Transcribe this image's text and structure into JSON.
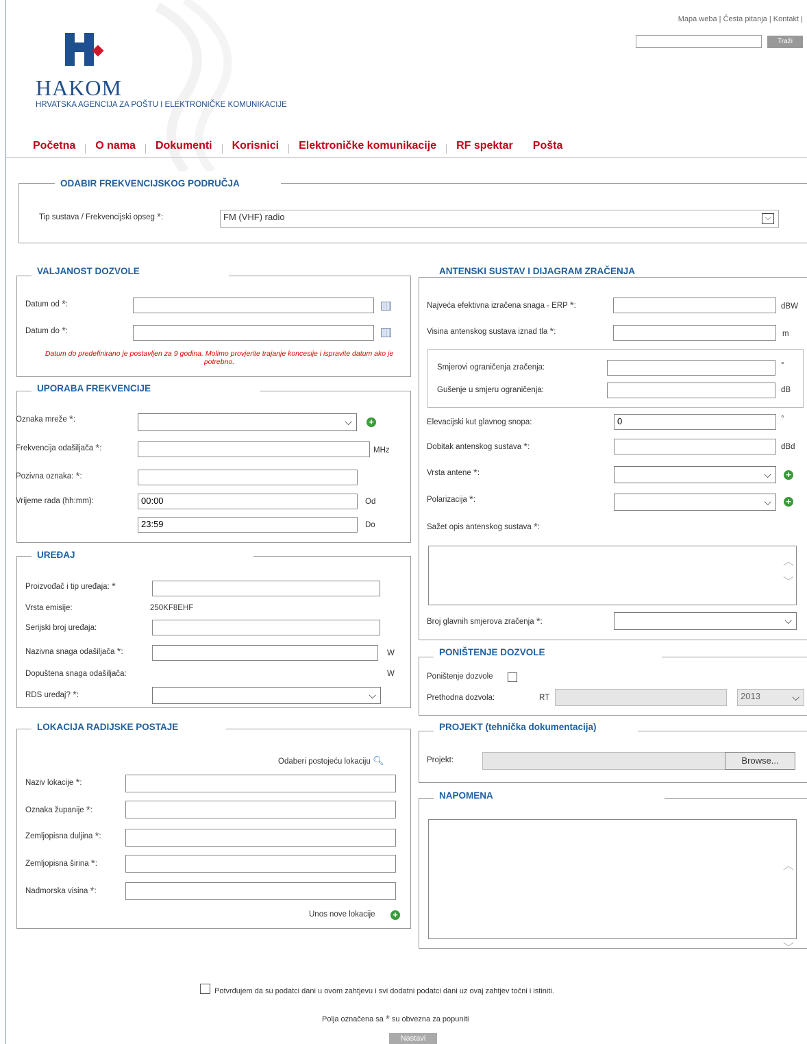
{
  "header": {
    "links": [
      "Mapa weba",
      "Česta pitanja",
      "Kontakt"
    ],
    "search_button": "Traži",
    "brand": "HAKOM",
    "subtitle": "HRVATSKA AGENCIJA ZA POŠTU I ELEKTRONIČKE KOMUNIKACIJE"
  },
  "nav": [
    "Početna",
    "O nama",
    "Dokumenti",
    "Korisnici",
    "Elektroničke komunikacije",
    "RF spektar",
    "Pošta"
  ],
  "freq": {
    "legend": "ODABIR FREKVENCIJSKOG PODRUČJA",
    "label": "Tip sustava / Frekvencijski opseg",
    "value": "FM (VHF) radio"
  },
  "validity": {
    "legend": "VALJANOST DOZVOLE",
    "date_from": "Datum od",
    "date_to": "Datum do",
    "note": "Datum do predefinirano je postavljen za 9 godina. Molimo provjerite trajanje koncesije i ispravite datum ako je potrebno."
  },
  "usage": {
    "legend": "UPORABA FREKVENCIJE",
    "network": "Oznaka mreže",
    "freq": "Frekvencija odašiljača",
    "freq_unit": "MHz",
    "callsign": "Pozivna oznaka:",
    "time": "Vrijeme rada (hh:mm):",
    "time_from": "00:00",
    "time_to": "23:59",
    "from_lbl": "Od",
    "to_lbl": "Do"
  },
  "device": {
    "legend": "UREĐAJ",
    "maker": "Proizvođač i tip uređaja:",
    "emission_lbl": "Vrsta emisije:",
    "emission_val": "250KF8EHF",
    "serial": "Serijski broj uređaja:",
    "power": "Nazivna snaga odašiljača",
    "power_unit": "W",
    "allowed": "Dopuštena snaga odašiljača:",
    "allowed_unit": "W",
    "rds": "RDS uređaj?"
  },
  "location": {
    "legend": "LOKACIJA RADIJSKE POSTAJE",
    "choose": "Odaberi postojeću lokaciju",
    "name": "Naziv lokacije",
    "county": "Oznaka županije",
    "lon": "Zemljopisna duljina",
    "lat": "Zemljopisna širina",
    "alt": "Nadmorska visina",
    "new_loc": "Unos nove lokacije"
  },
  "antenna": {
    "legend": "ANTENSKI SUSTAV I DIJAGRAM ZRAČENJA",
    "erp": "Najveća efektivna izračena snaga - ERP",
    "erp_unit": "dBW",
    "height": "Visina antenskog sustava iznad tla",
    "height_unit": "m",
    "dirs": "Smjerovi ograničenja zračenja:",
    "dirs_unit": "°",
    "att": "Gušenje u smjeru ograničenja:",
    "att_unit": "dB",
    "elev": "Elevacijski kut glavnog snopa:",
    "elev_val": "0",
    "elev_unit": "°",
    "gain": "Dobitak antenskog sustava",
    "gain_unit": "dBd",
    "type": "Vrsta antene",
    "pol": "Polarizacija",
    "desc": "Sažet opis antenskog sustava",
    "dircount": "Broj glavnih smjerova zračenja"
  },
  "cancel": {
    "legend": "PONIŠTENJE DOZVOLE",
    "cancel_lbl": "Poništenje dozvole",
    "prev": "Prethodna dozvola:",
    "rt": "RT",
    "year": "2013"
  },
  "project": {
    "legend": "PROJEKT (tehnička dokumentacija)",
    "label": "Projekt:",
    "browse": "Browse..."
  },
  "note": {
    "legend": "NAPOMENA"
  },
  "footer": {
    "confirm": "Potvrđujem da su podatci dani u ovom zahtjevu i svi dodatni podatci dani uz ovaj zahtjev točni i istiniti.",
    "req_pre": "Polja označena sa",
    "req_post": "su obvezna za popuniti",
    "next": "Nastavi"
  }
}
